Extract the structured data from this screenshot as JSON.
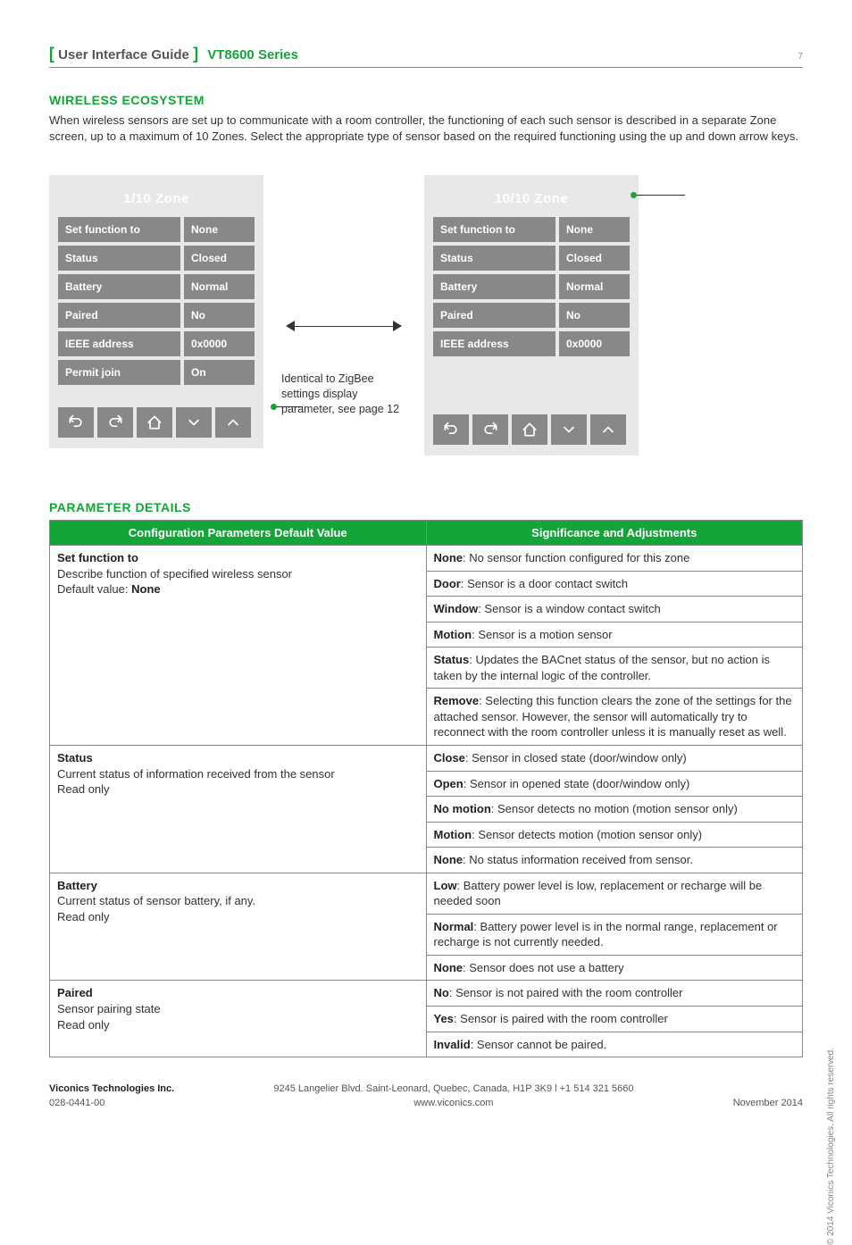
{
  "header": {
    "title": "User Interface Guide",
    "series": "VT8600 Series",
    "page": "7"
  },
  "section1": {
    "title": "WIRELESS ECOSYSTEM",
    "intro": "When wireless sensors are set up to communicate with a room controller, the functioning of each such sensor is described in a separate Zone screen, up to a maximum of 10 Zones. Select the appropriate type of sensor based on the required functioning using the up and down arrow keys."
  },
  "panelA": {
    "title": "1/10 Zone",
    "rows": [
      {
        "label": "Set function to",
        "value": "None"
      },
      {
        "label": "Status",
        "value": "Closed"
      },
      {
        "label": "Battery",
        "value": "Normal"
      },
      {
        "label": "Paired",
        "value": "No"
      },
      {
        "label": "IEEE address",
        "value": "0x0000"
      },
      {
        "label": "Permit join",
        "value": "On"
      }
    ]
  },
  "panelB": {
    "title": "10/10 Zone",
    "rows": [
      {
        "label": "Set function to",
        "value": "None"
      },
      {
        "label": "Status",
        "value": "Closed"
      },
      {
        "label": "Battery",
        "value": "Normal"
      },
      {
        "label": "Paired",
        "value": "No"
      },
      {
        "label": "IEEE address",
        "value": "0x0000"
      }
    ]
  },
  "middle_note": "Identical to ZigBee settings display parameter, see page 12",
  "section2_title": "PARAMETER DETAILS",
  "table": {
    "head1": "Configuration Parameters Default Value",
    "head2": "Significance and Adjustments",
    "rows": [
      {
        "left": {
          "t": "Set function to",
          "d": "Describe function of specified wireless sensor",
          "e": "Default value: ",
          "eb": "None"
        },
        "right": [
          {
            "b": "None",
            "t": ": No sensor function configured for this zone"
          },
          {
            "b": "Door",
            "t": ": Sensor is a door contact switch"
          },
          {
            "b": "Window",
            "t": ": Sensor is a window contact switch"
          },
          {
            "b": "Motion",
            "t": ": Sensor is a motion sensor"
          },
          {
            "b": "Status",
            "t": ": Updates the BACnet status of the sensor, but no action is taken by the internal logic of the controller."
          },
          {
            "b": "Remove",
            "t": ": Selecting this function clears the zone of the settings for the attached sensor. However, the sensor will automatically try to reconnect with the room controller unless it is manually reset as well."
          }
        ]
      },
      {
        "left": {
          "t": "Status",
          "d": "Current status of information received from the sensor",
          "e": "Read only"
        },
        "right": [
          {
            "b": "Close",
            "t": ": Sensor in closed state (door/window only)"
          },
          {
            "b": "Open",
            "t": ": Sensor in opened state (door/window only)"
          },
          {
            "b": "No motion",
            "t": ": Sensor detects no motion (motion sensor only)"
          },
          {
            "b": "Motion",
            "t": ": Sensor detects motion (motion sensor only)"
          },
          {
            "b": "None",
            "t": ": No status information received from sensor."
          }
        ]
      },
      {
        "left": {
          "t": "Battery",
          "d": "Current status of sensor battery, if any.",
          "e": "Read only"
        },
        "right": [
          {
            "b": "Low",
            "t": ": Battery power level is low, replacement or recharge will be needed soon"
          },
          {
            "b": "Normal",
            "t": ": Battery power level is in the normal range, replacement or recharge is not currently needed."
          },
          {
            "b": "None",
            "t": ": Sensor does not use a battery"
          }
        ]
      },
      {
        "left": {
          "t": "Paired",
          "d": "Sensor pairing state",
          "e": "Read only"
        },
        "right": [
          {
            "b": "No",
            "t": ": Sensor is not paired with the room controller"
          },
          {
            "b": "Yes",
            "t": ": Sensor is paired with the room controller"
          },
          {
            "b": "Invalid",
            "t": ": Sensor cannot be paired."
          }
        ]
      }
    ]
  },
  "footer": {
    "company": "Viconics Technologies Inc.",
    "doc": "028-0441-00",
    "addr": "9245 Langelier Blvd. Saint-Leonard, Quebec, Canada, H1P 3K9  l  +1 514 321 5660",
    "web": "www.viconics.com",
    "date": "November 2014"
  },
  "copyright": "© 2014 Viconics Technologies. All rights reserved."
}
